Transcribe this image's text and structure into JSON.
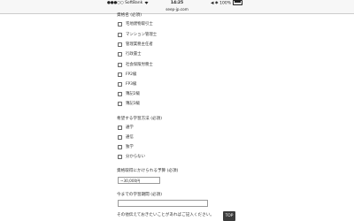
{
  "status_bar": {
    "signal": "●●●○○",
    "carrier": "SoftBank",
    "wifi_icon": "wifi-icon",
    "time": "14:25",
    "indicators": "◀ ✱",
    "battery_percent": "100%"
  },
  "browser": {
    "url": "seep-jp.com"
  },
  "qualification": {
    "label": "資格名 (必須)",
    "options": [
      "宅地建物取引士",
      "マンション管理士",
      "管理業務主任者",
      "行政書士",
      "社会保険労務士",
      "FP2級",
      "FP3級",
      "簿記2級",
      "簿記3級"
    ]
  },
  "study_method": {
    "label": "希望する学習方法 (必須)",
    "options": [
      "通学",
      "通信",
      "独学",
      "分からない"
    ]
  },
  "budget": {
    "label": "資格取得にかけられる予算 (必須)",
    "value": "~30,000円"
  },
  "past_study": {
    "label": "今までの学習期間 (必須)",
    "value": ""
  },
  "other_notes": {
    "label": "その他伝えておきたいことがあればご記入ください。"
  },
  "top_button": {
    "label": "TOP"
  }
}
